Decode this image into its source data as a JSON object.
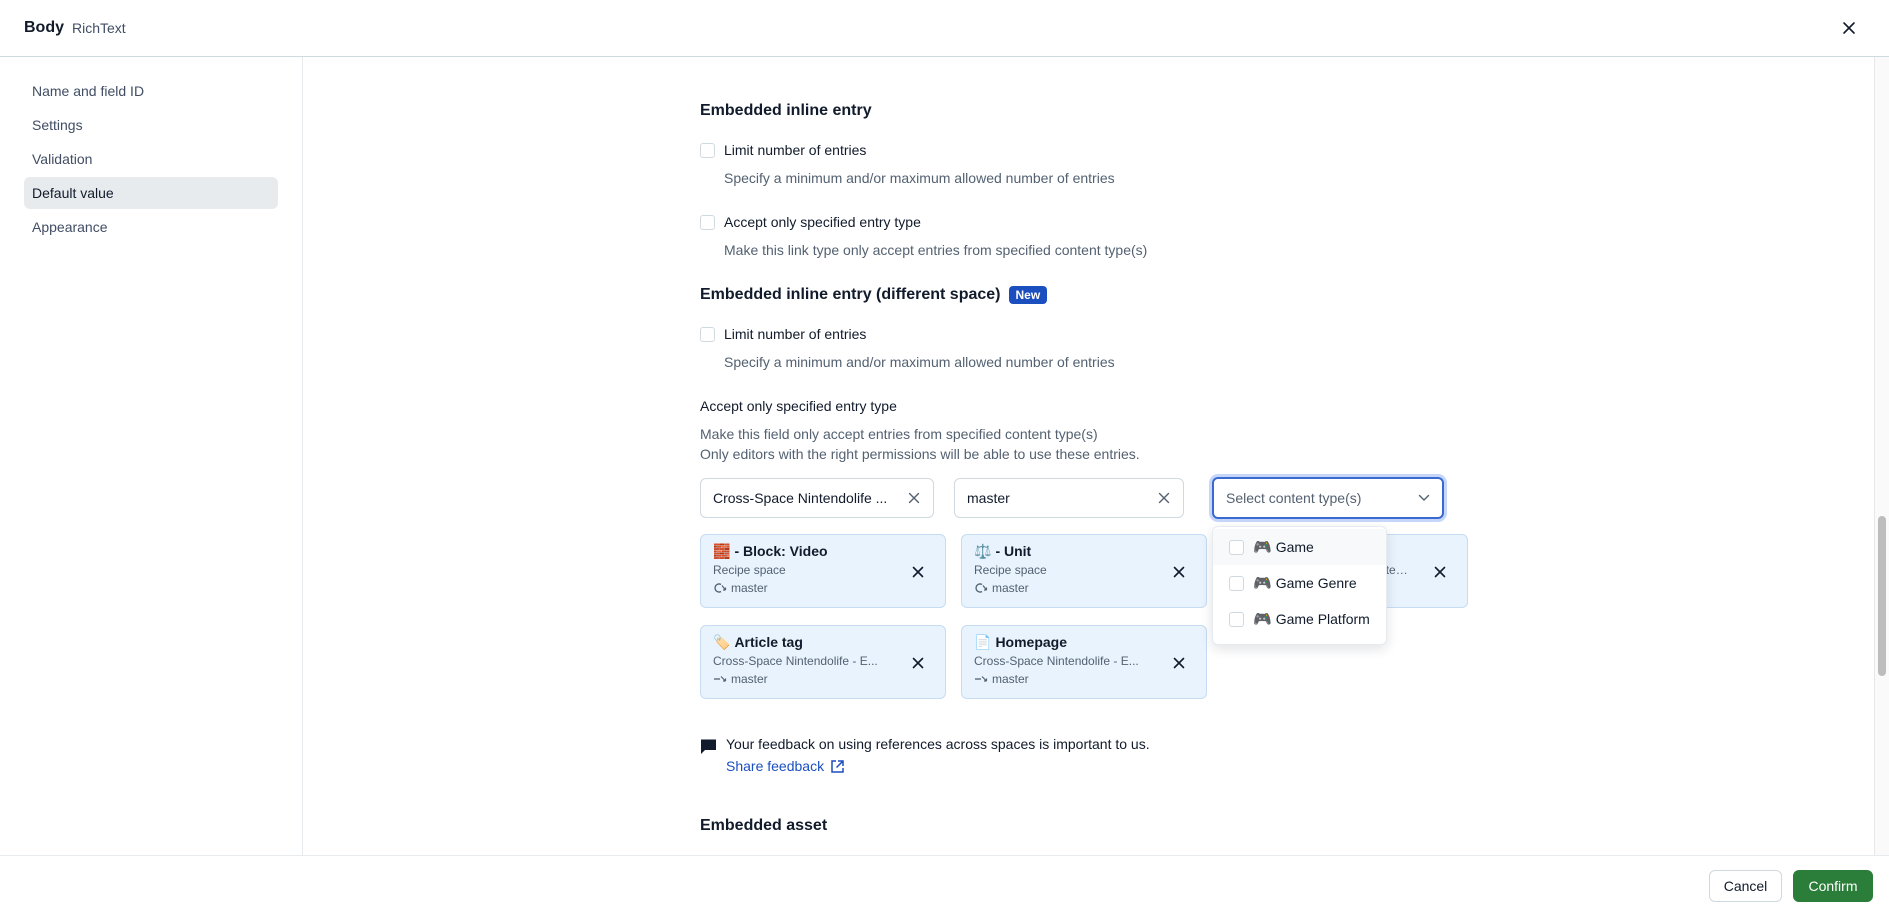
{
  "header": {
    "title": "Body",
    "subtitle": "RichText"
  },
  "sidebar": {
    "items": [
      {
        "label": "Name and field ID",
        "active": false
      },
      {
        "label": "Settings",
        "active": false
      },
      {
        "label": "Validation",
        "active": false
      },
      {
        "label": "Default value",
        "active": true
      },
      {
        "label": "Appearance",
        "active": false
      }
    ]
  },
  "inline_entry": {
    "title": "Embedded inline entry",
    "limit_label": "Limit number of entries",
    "limit_help": "Specify a minimum and/or maximum allowed number of entries",
    "accept_label": "Accept only specified entry type",
    "accept_help": "Make this link type only accept entries from specified content type(s)"
  },
  "inline_entry_cross": {
    "title": "Embedded inline entry (different space)",
    "badge": "New",
    "limit_label": "Limit number of entries",
    "limit_help": "Specify a minimum and/or maximum allowed number of entries",
    "accept_label": "Accept only specified entry type",
    "accept_help_1": "Make this field only accept entries from specified content type(s)",
    "accept_help_2": "Only editors with the right permissions will be able to use these entries.",
    "space_select": "Cross-Space Nintendolife ...",
    "env_select": "master",
    "content_type_placeholder": "Select content type(s)",
    "cards": [
      {
        "emoji": "🧱",
        "name": "- Block: Video",
        "space": "Recipe space",
        "env": "master"
      },
      {
        "emoji": "⚖️",
        "name": "- Unit",
        "space": "Recipe space",
        "env": "master"
      },
      {
        "emoji": "",
        "name": "",
        "space": "Cross-Space Nintendolife - E...",
        "env": ""
      },
      {
        "emoji": "🏷️",
        "name": "Article tag",
        "space": "Cross-Space Nintendolife - E...",
        "env": "master"
      },
      {
        "emoji": "📄",
        "name": "Homepage",
        "space": "Cross-Space Nintendolife - E...",
        "env": "master"
      }
    ],
    "dropdown_options": [
      {
        "emoji": "🎮",
        "label": "Game",
        "checked": false
      },
      {
        "emoji": "🎮",
        "label": "Game Genre",
        "checked": false
      },
      {
        "emoji": "🎮",
        "label": "Game Platform",
        "checked": false
      }
    ],
    "feedback_message": "Your feedback on using references across spaces is important to us.",
    "feedback_link": "Share feedback"
  },
  "embedded_asset": {
    "title": "Embedded asset"
  },
  "footer": {
    "cancel_label": "Cancel",
    "confirm_label": "Confirm"
  },
  "colors": {
    "accent": "#1b4fc0",
    "confirm": "#2b7e3a",
    "card_bg": "#e8f3fd",
    "focus": "#3a6ad0"
  },
  "scroll": {
    "position_fraction": 0.62
  }
}
